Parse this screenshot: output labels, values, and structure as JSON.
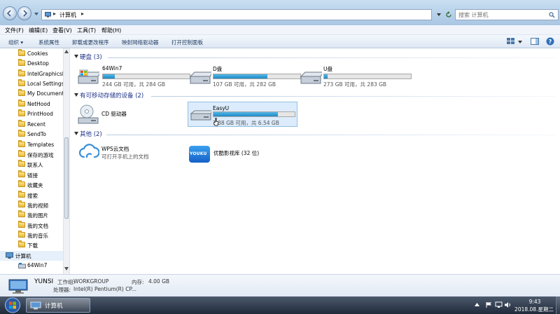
{
  "window": {
    "address_root_icon": "computer-icon",
    "address_text": "计算机",
    "address_sep": "▸",
    "search_placeholder": "搜索 计算机"
  },
  "menubar": [
    "文件(F)",
    "编辑(E)",
    "查看(V)",
    "工具(T)",
    "帮助(H)"
  ],
  "toolbar": {
    "organize": "组织 ▾",
    "items": [
      "系统属性",
      "卸载或更改程序",
      "映射网络驱动器",
      "打开控制面板"
    ]
  },
  "nav": {
    "folders": [
      "Cookies",
      "Desktop",
      "IntelGraphicsP",
      "Local Settings",
      "My Documents",
      "NetHood",
      "PrintHood",
      "Recent",
      "SendTo",
      "Templates",
      "保存的游戏",
      "联系人",
      "链接",
      "收藏夹",
      "搜索",
      "我的视频",
      "我的图片",
      "我的文档",
      "我的音乐",
      "下载"
    ],
    "computer": "计算机",
    "drive": "64Win7"
  },
  "groups": {
    "hdd": "硬盘 (3)",
    "removable": "有可移动存储的设备 (2)",
    "other": "其他 (2)"
  },
  "drives": [
    {
      "name": "64Win7",
      "detail": "244 GB 可用，共 284 GB",
      "used_fraction": 0.14
    },
    {
      "name": "D盘",
      "detail": "107 GB 可用，共 282 GB",
      "used_fraction": 0.62
    },
    {
      "name": "U盘",
      "detail": "273 GB 可用，共 283 GB",
      "used_fraction": 0.04
    }
  ],
  "removable": [
    {
      "name": "CD 驱动器"
    },
    {
      "name": "EasyU",
      "detail": "1.38 GB 可用，共 6.54 GB",
      "used_fraction": 0.79
    }
  ],
  "other": [
    {
      "name": "WPS云文档",
      "detail": "可打开手机上的文档",
      "icon": "cloud-icon"
    },
    {
      "name": "优酷影视库 (32 位)",
      "icon": "youku-icon",
      "icon_text": "YOUKU"
    }
  ],
  "details": {
    "computer_name": "YUNSI",
    "workgroup_label": "工作组:",
    "workgroup": "WORKGROUP",
    "memory_label": "内存:",
    "memory": "4.00 GB",
    "cpu_label": "处理器:",
    "cpu": "Intel(R) Pentium(R) CP..."
  },
  "taskbar": {
    "task_label": "计算机",
    "time": "9:43",
    "date": "2018.08.星期二"
  },
  "colors": {
    "accent": "#1f89c8",
    "group_header": "#1e3287",
    "taskbar": "#1f2a3a"
  }
}
